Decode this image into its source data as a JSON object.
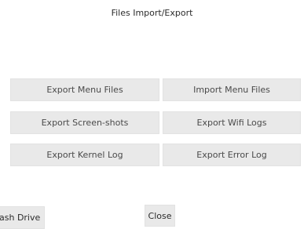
{
  "window": {
    "title": "Files Import/Export"
  },
  "buttons": {
    "export_menu_files": "Export Menu Files",
    "import_menu_files": "Import Menu Files",
    "export_screenshots": "Export Screen-shots",
    "export_wifi_logs": "Export Wifi Logs",
    "export_kernel_log": "Export Kernel Log",
    "export_error_log": "Export Error Log",
    "flash_drive": "ash Drive",
    "close": "Close"
  }
}
